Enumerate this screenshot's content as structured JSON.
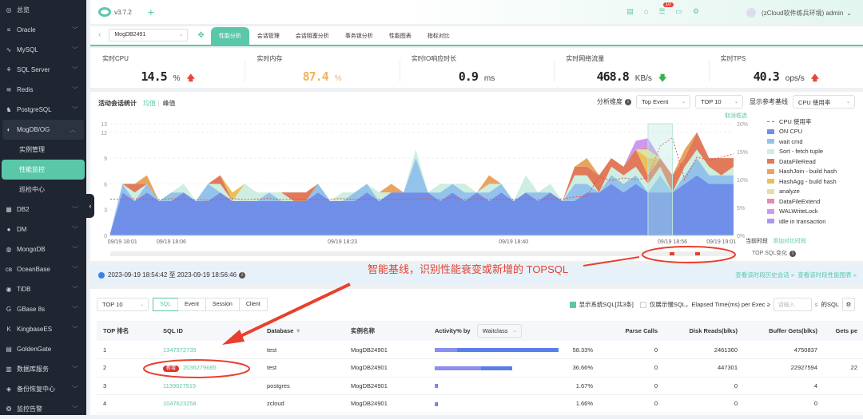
{
  "sidebar": {
    "items": [
      {
        "label": "总览",
        "icon": "dashboard-icon",
        "chev": false
      },
      {
        "label": "Oracle",
        "icon": "database-icon",
        "chev": true
      },
      {
        "label": "MySQL",
        "icon": "dolphin-icon",
        "chev": true
      },
      {
        "label": "SQL Server",
        "icon": "sqlserver-icon",
        "chev": true
      },
      {
        "label": "Redis",
        "icon": "stack-icon",
        "chev": true
      },
      {
        "label": "PostgreSQL",
        "icon": "elephant-icon",
        "chev": true
      }
    ],
    "open": {
      "label": "MogDB/OG",
      "sub": [
        "实例管理",
        "性能监控",
        "巡检中心"
      ]
    },
    "rest": [
      {
        "label": "DB2"
      },
      {
        "label": "DM"
      },
      {
        "label": "MongoDB"
      },
      {
        "label": "OceanBase"
      },
      {
        "label": "TiDB"
      },
      {
        "label": "GBase 8s"
      },
      {
        "label": "KingbaseES"
      },
      {
        "label": "GoldenGate",
        "nochev": true
      },
      {
        "label": "数据库服务"
      },
      {
        "label": "备份恢复中心"
      },
      {
        "label": "监控告警"
      }
    ]
  },
  "header": {
    "version": "v3.7.2",
    "badge": "10",
    "user": "(zCloud软件练兵环境) admin"
  },
  "tabbar": {
    "instance": "MogDB2491",
    "tabs": [
      "性能分析",
      "会话管理",
      "会话阻塞分析",
      "事务锁分析",
      "性能图表",
      "指标对比"
    ]
  },
  "metrics": [
    {
      "label": "实时CPU",
      "value": "14.5",
      "unit": "%",
      "trend": "up",
      "color": "#222"
    },
    {
      "label": "实时内存",
      "value": "87.4",
      "unit": "%",
      "trend": "",
      "color": "#f0b35a"
    },
    {
      "label": "实时IO响应时长",
      "value": "0.9",
      "unit": "ms",
      "trend": "",
      "color": "#222"
    },
    {
      "label": "实时网络流量",
      "value": "468.8",
      "unit": "KB/s",
      "trend": "down",
      "color": "#222"
    },
    {
      "label": "实时TPS",
      "value": "40.3",
      "unit": "ops/s",
      "trend": "up",
      "color": "#222"
    }
  ],
  "chart": {
    "title": "活动会话统计",
    "avg": "均值",
    "peak": "峰值",
    "dim_label": "分析维度",
    "dim_value": "Top  Event",
    "top_value": "TOP 10",
    "baseline_label": "显示参考基线",
    "baseline_value": "CPU 使用率",
    "cancel": "取消框选",
    "current": "当前时段",
    "add_compare": "添加对比时段",
    "topsql_change": "TOP SQL变化"
  },
  "chart_data": {
    "type": "area",
    "stacked": true,
    "yticks": [
      "0",
      "3",
      "6",
      "9",
      "12",
      "13"
    ],
    "ylim": [
      0,
      13
    ],
    "y2ticks": [
      "0%",
      "5%",
      "10%",
      "15%",
      "20%"
    ],
    "y2lim": [
      0,
      20
    ],
    "xticks": [
      {
        "label": "09/19 18:01",
        "i": 1
      },
      {
        "label": "09/19 18:06",
        "i": 5
      },
      {
        "label": "09/19 18:23",
        "i": 19
      },
      {
        "label": "09/19 18:40",
        "i": 33
      },
      {
        "label": "09/19 18:56",
        "i": 46
      },
      {
        "label": "09/19 19:01",
        "i": 50
      }
    ],
    "n": 52,
    "series": [
      {
        "name": "ON CPU",
        "color": "#6f8fe8",
        "values": [
          0.3,
          5,
          4,
          5,
          4,
          4,
          5,
          4,
          4,
          5,
          4,
          4,
          4,
          4,
          4,
          4,
          4,
          5,
          4,
          4,
          4,
          5,
          4,
          5,
          5,
          5,
          5,
          4,
          5,
          4,
          5,
          4,
          5,
          4,
          5,
          4,
          5,
          4,
          4,
          5,
          5,
          6,
          5,
          6,
          5,
          5,
          5,
          6,
          7,
          6,
          6,
          6
        ]
      },
      {
        "name": "wait cmd",
        "color": "#93c3ea",
        "values": [
          0,
          1,
          0,
          1,
          0,
          1,
          0,
          0,
          2,
          0,
          0,
          0,
          0,
          1,
          0,
          0,
          0,
          1,
          0,
          0,
          1,
          1,
          0,
          0,
          0,
          4,
          0,
          1,
          1,
          1,
          0,
          1,
          1,
          0,
          0,
          1,
          0,
          0,
          2,
          1,
          0,
          1,
          1,
          1,
          0,
          2,
          0,
          1,
          2,
          1,
          1,
          1
        ]
      },
      {
        "name": "Sort - fetch tuple",
        "color": "#cdeee0",
        "values": [
          0,
          0,
          1,
          0,
          0,
          0,
          1,
          0,
          0,
          1,
          0,
          2,
          1,
          0,
          1,
          0,
          0,
          0,
          0,
          1,
          0,
          0,
          1,
          0,
          0,
          1,
          0,
          1,
          0,
          1,
          0,
          1,
          0,
          0,
          2,
          0,
          1,
          0,
          1,
          1,
          0,
          1,
          1,
          1,
          1,
          1,
          0,
          1,
          1,
          1,
          0,
          1
        ]
      },
      {
        "name": "DataFileRead",
        "color": "#e07a5a",
        "values": [
          0,
          0,
          1,
          0,
          0,
          0,
          0,
          0,
          0,
          1,
          0,
          0,
          0,
          0,
          0,
          1,
          1,
          0,
          0,
          0,
          0,
          0,
          0,
          0,
          0,
          0,
          0,
          0,
          0,
          0,
          0,
          0,
          0,
          0,
          0,
          0,
          0,
          0,
          1,
          1,
          2,
          1,
          1,
          2,
          1,
          1,
          2,
          1,
          2,
          1,
          2,
          1
        ]
      },
      {
        "name": "HashJoin - build hash",
        "color": "#eaa35e",
        "values": [
          0,
          0,
          0,
          1,
          0,
          0,
          0,
          0,
          0,
          0,
          0,
          0,
          0,
          0,
          0,
          0,
          0,
          0,
          0,
          0,
          0,
          0,
          0,
          1,
          0,
          0,
          0,
          0,
          0,
          0,
          0,
          1,
          0,
          0,
          0,
          0,
          0,
          0,
          0,
          1,
          0,
          0,
          0,
          0,
          0,
          0,
          0,
          1,
          0,
          0,
          0,
          0
        ]
      },
      {
        "name": "HashAgg - build hash",
        "color": "#e9c05a",
        "values": [
          0,
          0,
          0,
          0,
          0,
          0,
          0,
          0,
          0,
          0,
          1,
          0,
          0,
          0,
          0,
          0,
          0,
          0,
          0,
          0,
          0,
          0,
          0,
          0,
          0,
          0,
          0,
          0,
          0,
          0,
          0,
          0,
          0,
          0,
          0,
          0,
          0,
          0,
          0,
          0,
          0,
          0,
          0,
          0,
          2,
          0,
          0,
          0,
          0,
          0,
          0,
          0
        ]
      },
      {
        "name": "analyze",
        "color": "#dde3a0",
        "values": [
          0,
          0,
          0,
          0,
          0,
          0,
          0,
          0,
          0,
          0,
          0,
          0,
          0,
          0,
          0,
          0,
          0,
          0,
          0,
          0,
          0,
          0,
          0,
          0,
          0,
          0,
          0,
          0,
          0,
          0,
          0,
          0,
          0,
          0,
          0,
          0,
          0,
          0,
          0,
          0,
          0,
          0,
          0,
          0,
          1,
          0,
          0,
          0,
          0,
          0,
          0,
          0
        ]
      },
      {
        "name": "DataFileExtend",
        "color": "#e58bb0",
        "values": [
          0,
          0,
          0,
          0,
          0,
          0,
          0,
          0,
          0,
          0,
          0,
          0,
          0,
          0,
          0,
          0,
          0,
          0,
          0,
          0,
          0,
          0,
          0,
          0,
          0,
          0,
          0,
          0,
          0,
          0,
          0,
          0,
          0,
          0,
          0,
          0,
          0,
          0,
          0,
          0,
          0,
          0,
          0,
          0,
          0.3,
          0,
          0,
          0,
          0,
          0,
          0,
          0
        ]
      },
      {
        "name": "WALWriteLock",
        "color": "#cc99ee",
        "values": [
          0,
          0,
          0,
          0,
          0,
          0,
          0,
          0,
          0,
          0,
          0,
          0,
          0,
          0,
          0,
          0,
          0,
          0,
          0,
          0,
          0,
          0,
          0,
          0,
          0,
          0,
          0,
          0,
          0,
          0,
          0,
          0,
          0,
          0,
          0,
          0,
          0,
          0,
          0,
          0,
          0,
          0,
          0,
          1,
          1,
          0,
          0,
          0,
          0,
          0,
          0,
          0
        ]
      },
      {
        "name": "idle in transaction",
        "color": "#a99aef",
        "values": [
          0,
          0,
          0,
          0,
          0,
          0,
          0,
          0,
          0,
          0,
          0,
          0,
          0,
          0,
          0,
          0,
          0,
          0,
          0,
          0,
          0,
          0,
          0,
          0,
          0,
          0,
          0,
          0,
          0,
          0,
          0,
          0,
          0,
          0,
          0,
          0,
          0,
          0,
          0,
          0,
          0,
          0,
          0,
          0,
          0,
          0,
          0,
          0,
          0,
          0,
          0,
          0
        ]
      }
    ],
    "line": {
      "name": "CPU 使用率",
      "color": "#e8504a",
      "values": [
        6.5,
        6.5,
        6.6,
        6.5,
        6.4,
        6.6,
        6.5,
        6.4,
        6.3,
        6.5,
        6.6,
        6.4,
        6.5,
        6.6,
        6.4,
        6.5,
        6.5,
        6.4,
        6.5,
        6.6,
        6.4,
        6.5,
        6.5,
        6.4,
        6.4,
        6.5,
        6.6,
        6.4,
        6.8,
        6.4,
        6.6,
        6.5,
        6.4,
        6.5,
        6.5,
        6.4,
        6.6,
        6.5,
        6.9,
        7,
        10.5,
        9.8,
        10.3,
        10,
        10.3,
        16,
        17.5,
        10,
        14,
        13.5,
        14,
        14.6
      ]
    },
    "selection": {
      "from_index": 44,
      "to_index": 46
    }
  },
  "range": {
    "text": "2023-09-19 18:54:42 至 2023-09-19 18:56:46",
    "link1": "查看该时段历史会话 »",
    "link2": "查看该时段性能图表 »"
  },
  "annotation": {
    "text": "智能基线，识别性能衰变或新增的 TOPSQL"
  },
  "table": {
    "top": "TOP 10",
    "segments": [
      "SQL",
      "Event",
      "Session",
      "Client"
    ],
    "show_sys": "显示系统SQL[共3条]",
    "slow_only": "仅展示慢SQL，Elapsed Time(ms) per Exec ≥",
    "placeholder": "请输入",
    "unit": "s",
    "suffix": "的SQL",
    "headers": [
      "TOP 排名",
      "SQL ID",
      "Database",
      "实例名称",
      "Activity% by",
      "Parse Calls",
      "Disk Reads(blks)",
      "Buffer Gets(blks)",
      "Gets pe"
    ],
    "waitclass": "Waitclass",
    "new_tag": "新增",
    "rows": [
      {
        "rank": "1",
        "id": "1347972735",
        "db": "test",
        "inst": "MogDB24901",
        "pct": "58.33%",
        "act": 58.33,
        "parse": "0",
        "disk": "2461360",
        "buf": "4750837",
        "gets": "",
        "isnew": false
      },
      {
        "rank": "2",
        "id": "2036279685",
        "db": "test",
        "inst": "MogDB24901",
        "pct": "36.66%",
        "act": 36.66,
        "parse": "0",
        "disk": "447301",
        "buf": "22927594",
        "gets": "22",
        "isnew": true
      },
      {
        "rank": "3",
        "id": "1139027515",
        "db": "postgres",
        "inst": "MogDB24901",
        "pct": "1.67%",
        "act": 1.67,
        "parse": "0",
        "disk": "0",
        "buf": "4",
        "gets": "",
        "isnew": false
      },
      {
        "rank": "4",
        "id": "1047623258",
        "db": "zcloud",
        "inst": "MogDB24901",
        "pct": "1.66%",
        "act": 1.66,
        "parse": "0",
        "disk": "0",
        "buf": "0",
        "gets": "",
        "isnew": false
      }
    ]
  }
}
